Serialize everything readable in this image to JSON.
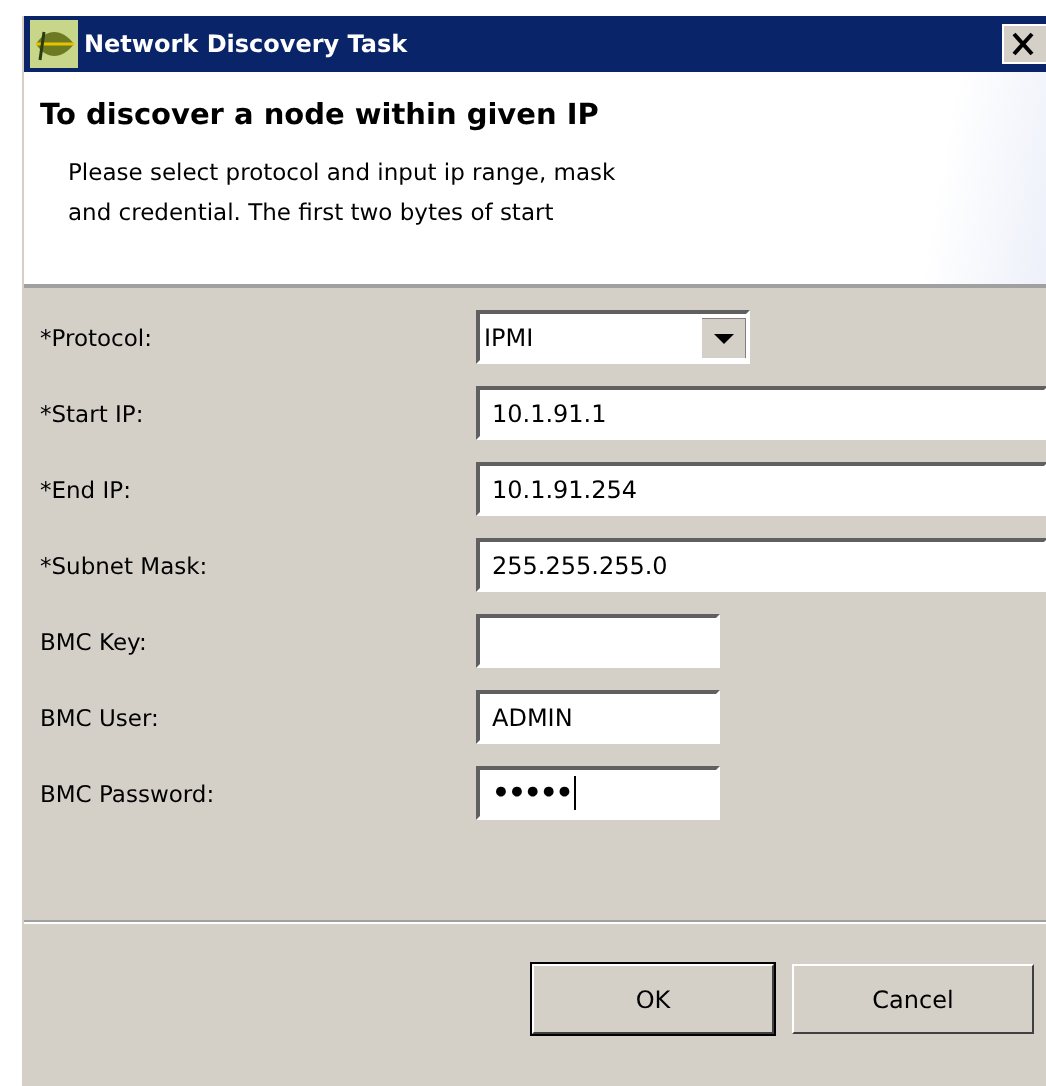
{
  "window": {
    "title": "Network Discovery Task"
  },
  "header": {
    "title": "To discover a node within given IP",
    "description": "Please select protocol and input ip range, mask\nand credential. The first two bytes of start"
  },
  "fields": [
    {
      "label": "*Protocol:",
      "kind": "select",
      "value": "IPMI",
      "focused": false
    },
    {
      "label": "*Start IP:",
      "kind": "wide_text",
      "value": "10.1.91.1",
      "focused": false
    },
    {
      "label": "*End IP:",
      "kind": "wide_text",
      "value": "10.1.91.254",
      "focused": false
    },
    {
      "label": "*Subnet Mask:",
      "kind": "wide_text",
      "value": "255.255.255.0",
      "focused": false
    },
    {
      "label": "BMC Key:",
      "kind": "text",
      "focused": false
    },
    {
      "label": "BMC User:",
      "kind": "text",
      "value": "ADMIN",
      "focused": false
    },
    {
      "label": "BMC Password:",
      "kind": "password",
      "value": "•••••",
      "focused": true
    }
  ],
  "buttons": [
    {
      "label": "OK",
      "default": true
    },
    {
      "label": "Cancel",
      "default": false
    }
  ]
}
